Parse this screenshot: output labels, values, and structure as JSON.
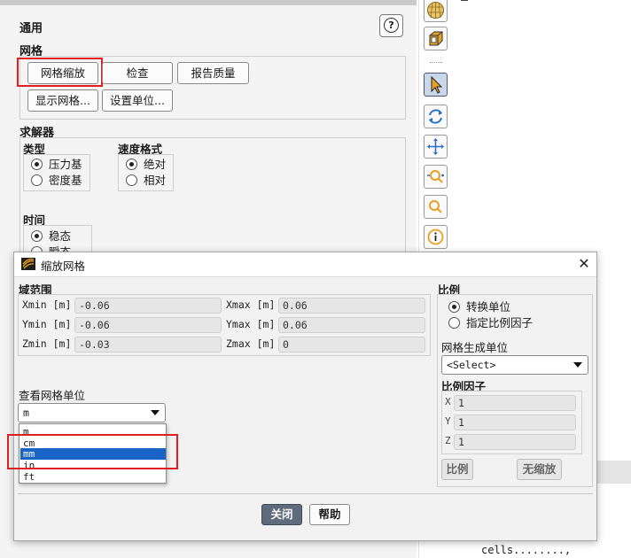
{
  "panel": {
    "title": "通用",
    "help_glyph": "?",
    "mesh": {
      "label": "网格",
      "buttons": [
        "网格缩放",
        "检查",
        "报告质量",
        "显示网格...",
        "设置单位..."
      ]
    },
    "solver": {
      "label": "求解器",
      "type": {
        "label": "类型",
        "options": [
          "压力基",
          "密度基"
        ],
        "selected": 0
      },
      "velocity": {
        "label": "速度格式",
        "options": [
          "绝对",
          "相对"
        ],
        "selected": 0
      },
      "time": {
        "label": "时间",
        "options": [
          "稳态",
          "瞬态"
        ],
        "selected": 0
      }
    }
  },
  "toolbar": {
    "icons": [
      "geodesic-sphere-icon",
      "box-view-icon",
      "pointer-icon",
      "rotate-icon",
      "pan-icon",
      "zoom-in-out-icon",
      "zoom-box-icon",
      "info-icon"
    ],
    "active_index": 2,
    "accent": "#c8d7ea"
  },
  "console": {
    "text": "cells........,"
  },
  "dialog": {
    "title": "缩放网格",
    "close_glyph": "✕",
    "domain": {
      "label": "域范围",
      "rows": [
        {
          "min_label": "Xmin [m]",
          "min": "-0.06",
          "max_label": "Xmax [m]",
          "max": "0.06"
        },
        {
          "min_label": "Ymin [m]",
          "min": "-0.06",
          "max_label": "Ymax [m]",
          "max": "0.06"
        },
        {
          "min_label": "Zmin [m]",
          "min": "-0.03",
          "max_label": "Zmax [m]",
          "max": "0"
        }
      ]
    },
    "view_units": {
      "label": "查看网格单位",
      "value": "m",
      "options": [
        "m",
        "cm",
        "mm",
        "in",
        "ft"
      ],
      "highlighted": "mm"
    },
    "scale": {
      "label": "比例",
      "options": [
        "转换单位",
        "指定比例因子"
      ],
      "selected": 0,
      "created_units_label": "网格生成单位",
      "created_units_value": "<Select>",
      "factor_label": "比例因子",
      "factors": [
        {
          "axis": "X",
          "value": "1"
        },
        {
          "axis": "Y",
          "value": "1"
        },
        {
          "axis": "Z",
          "value": "1"
        }
      ],
      "scale_button": "比例",
      "unscale_button": "无缩放"
    },
    "close_button": "关闭",
    "help_button": "帮助"
  },
  "colors": {
    "highlight_red": "#e02020",
    "selection_blue": "#1a64c8",
    "dark_button": "#5d6b7c"
  }
}
